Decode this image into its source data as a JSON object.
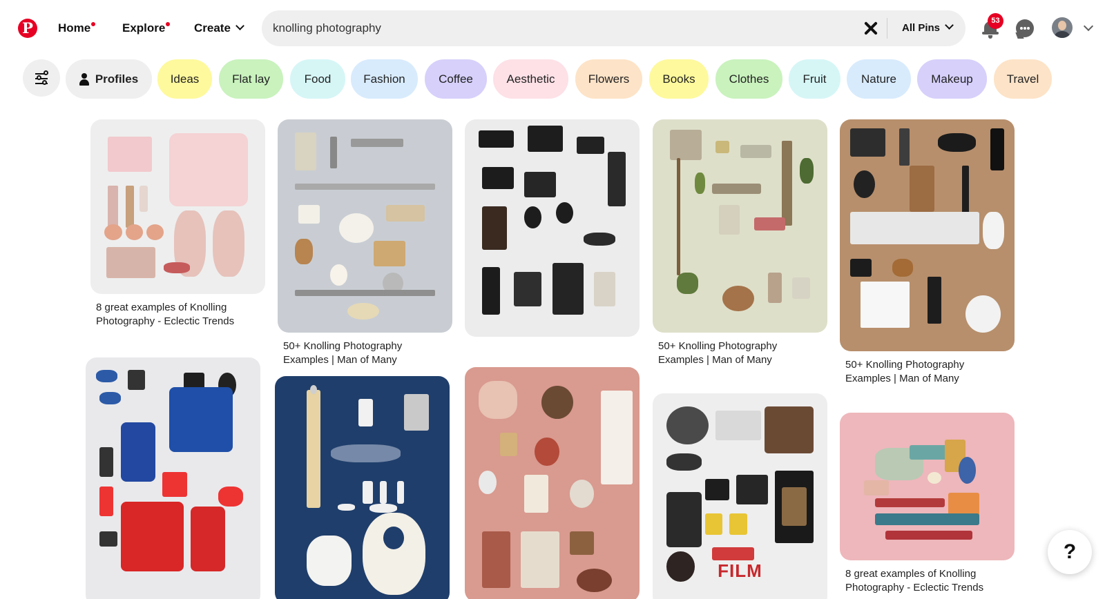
{
  "header": {
    "logo": "P",
    "nav": [
      {
        "label": "Home"
      },
      {
        "label": "Explore"
      },
      {
        "label": "Create"
      }
    ],
    "search": {
      "value": "knolling photography",
      "scope": "All Pins"
    },
    "notifications_count": "53"
  },
  "filters": {
    "profiles_label": "Profiles",
    "chips": [
      {
        "label": "Ideas",
        "color": "#fef99c"
      },
      {
        "label": "Flat lay",
        "color": "#c9f2bd"
      },
      {
        "label": "Food",
        "color": "#d6f6f6"
      },
      {
        "label": "Fashion",
        "color": "#d8ebfd"
      },
      {
        "label": "Coffee",
        "color": "#d6d0fb"
      },
      {
        "label": "Aesthetic",
        "color": "#fde1e7"
      },
      {
        "label": "Flowers",
        "color": "#fde3c7"
      },
      {
        "label": "Books",
        "color": "#fef99c"
      },
      {
        "label": "Clothes",
        "color": "#c9f2bd"
      },
      {
        "label": "Fruit",
        "color": "#d6f6f6"
      },
      {
        "label": "Nature",
        "color": "#d8ebfd"
      },
      {
        "label": "Makeup",
        "color": "#d6d0fb"
      },
      {
        "label": "Travel",
        "color": "#fde3c7"
      }
    ]
  },
  "pins": [
    {
      "title": "8 great examples of Knolling Photography - Eclectic Trends",
      "theme": "pink-fashion-items",
      "bg": "#eeeeee"
    },
    {
      "title": "50+ Knolling Photography Examples | Man of Many",
      "theme": "kitchen-utensils",
      "bg": "#c9cdd3"
    },
    {
      "title": "",
      "theme": "vintage-cameras",
      "bg": "#ececec"
    },
    {
      "title": "50+ Knolling Photography Examples | Man of Many",
      "theme": "garden-tools",
      "bg": "#dedfc9"
    },
    {
      "title": "50+ Knolling Photography Examples | Man of Many",
      "theme": "desk-items",
      "bg": "#b78f6c"
    },
    {
      "title": "",
      "theme": "sportswear",
      "bg": "#e9e9ec"
    },
    {
      "title": "",
      "theme": "guitar-parts",
      "bg": "#1f3e6b"
    },
    {
      "title": "",
      "theme": "stationery-on-pink",
      "bg": "#d99a8f"
    },
    {
      "title": "",
      "theme": "film-camera-gear",
      "bg": "#eeeeee",
      "caption_text": "FILM"
    },
    {
      "title": "8 great examples of Knolling Photography - Eclectic Trends",
      "theme": "sewing-machine",
      "bg": "#eeb7bb"
    }
  ],
  "help_button": "?"
}
